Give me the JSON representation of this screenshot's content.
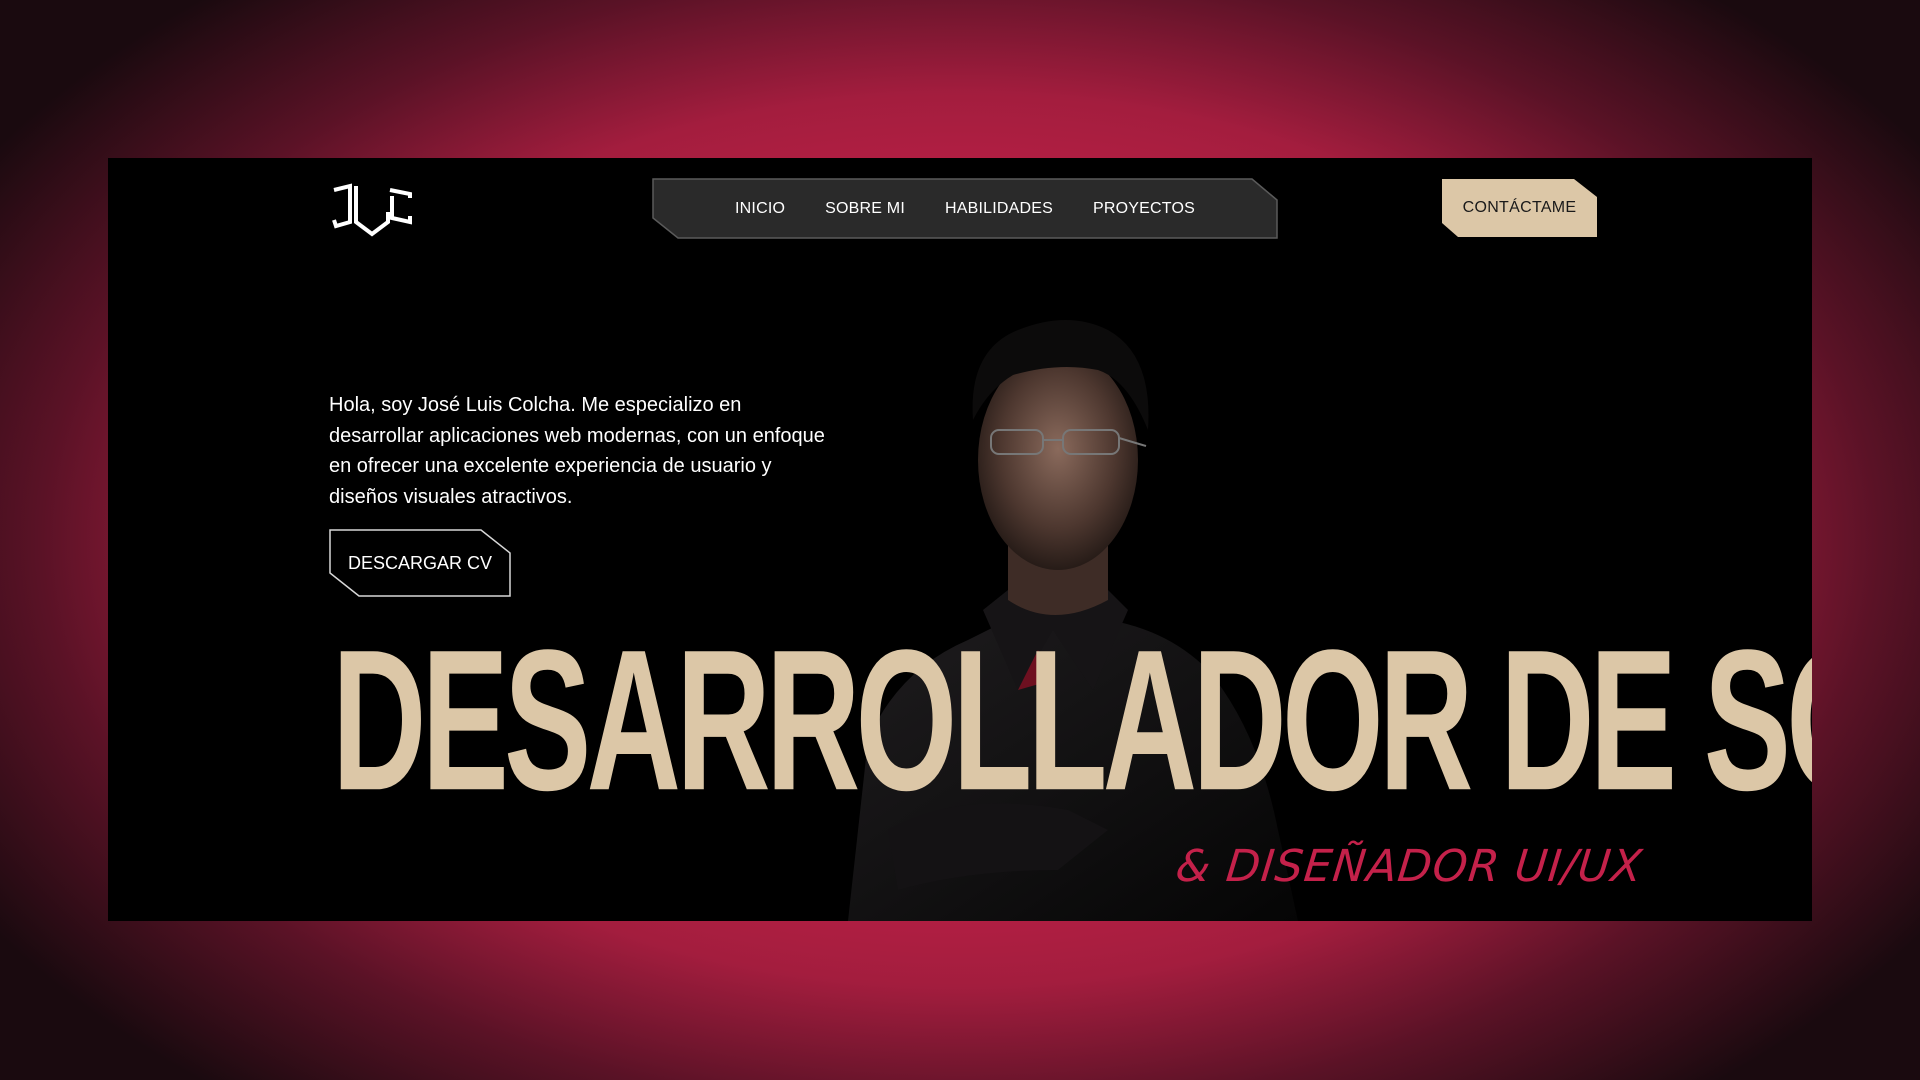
{
  "brand": {
    "logo_icon": "jlc-monogram-icon"
  },
  "nav": {
    "items": [
      {
        "label": "INICIO"
      },
      {
        "label": "SOBRE MI"
      },
      {
        "label": "HABILIDADES"
      },
      {
        "label": "PROYECTOS"
      }
    ]
  },
  "contact_button": {
    "label": "CONTÁCTAME"
  },
  "hero": {
    "intro": "Hola, soy José Luis Colcha. Me especializo en desarrollar aplicaciones web modernas, con un enfoque en ofrecer una excelente experiencia de usuario y diseños visuales atractivos.",
    "cta_label": "DESCARGAR CV",
    "headline": "DESARROLLADOR DE SOFTWARE",
    "subheadline": "& DISEÑADOR UI/UX"
  },
  "colors": {
    "accent": "#c4214a",
    "cream": "#dcc7a7",
    "nav_bg": "#2a2a2a",
    "page_bg": "#000000"
  }
}
